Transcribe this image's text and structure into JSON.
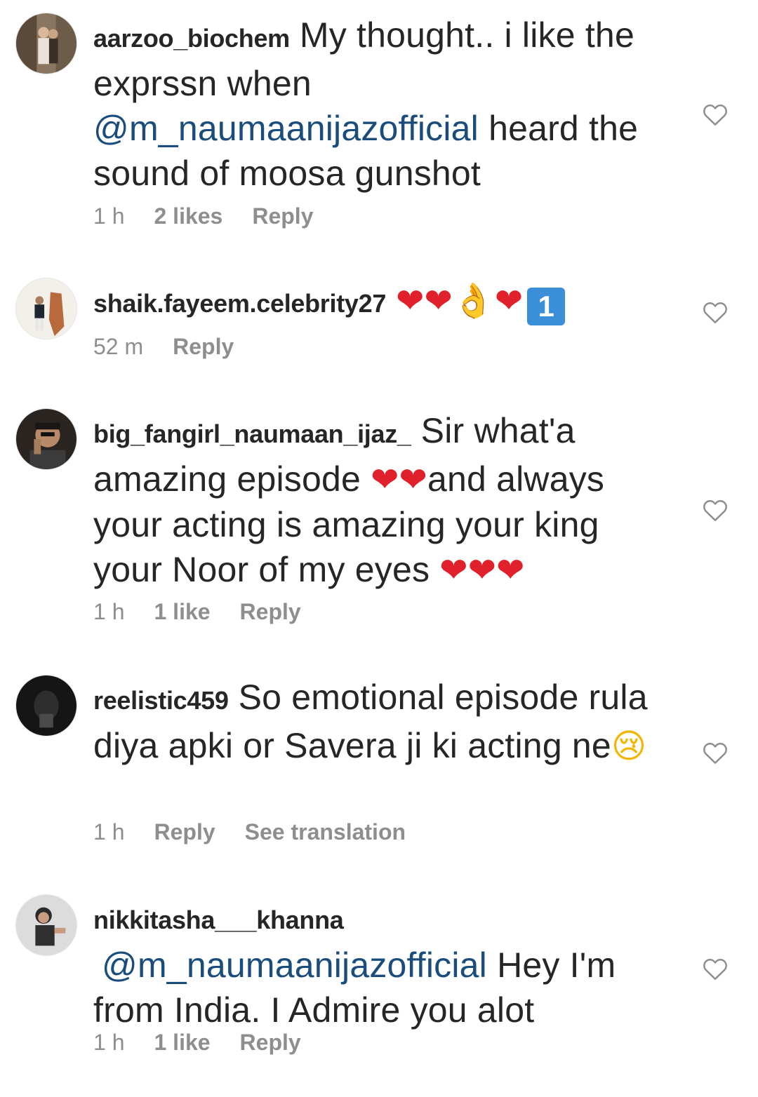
{
  "colors": {
    "mention": "#1a4d7c",
    "meta_text": "#8e8e8e",
    "body_text": "#262626",
    "heart_emoji": "#e0202a"
  },
  "comments": [
    {
      "username": "aarzoo_biochem",
      "text_a": "My thought.. i like the exprssn when",
      "mention": "@m_naumaanijazofficial",
      "text_b": "heard the sound of moosa gunshot",
      "time": "1 h",
      "likes": "2 likes",
      "reply": "Reply",
      "like_icon": "heart-outline-icon"
    },
    {
      "username": "shaik.fayeem.celebrity27",
      "emojis": [
        "❤",
        "❤",
        "👌",
        "❤",
        "1"
      ],
      "time": "52 m",
      "reply": "Reply",
      "like_icon": "heart-outline-icon"
    },
    {
      "username": "big_fangirl_naumaan_ijaz_",
      "text_a": "Sir what'a amazing episode",
      "emojis_a": [
        "❤",
        "❤"
      ],
      "text_b": "and always your acting is amazing your king your Noor of my eyes",
      "emojis_b": [
        "❤",
        "❤",
        "❤"
      ],
      "time": "1 h",
      "likes": "1 like",
      "reply": "Reply",
      "like_icon": "heart-outline-icon"
    },
    {
      "username": "reelistic459",
      "text_a": "So emotional episode rula diya apki or Savera ji ki acting ne",
      "emoji": "😢",
      "time": "1 h",
      "reply": "Reply",
      "translate": "See translation",
      "like_icon": "heart-outline-icon"
    },
    {
      "username": "nikkitasha___khanna",
      "mention": "@m_naumaanijazofficial",
      "text_b": "Hey I'm from India. I Admire you alot",
      "time": "1 h",
      "likes": "1 like",
      "reply": "Reply",
      "like_icon": "heart-outline-icon"
    }
  ]
}
